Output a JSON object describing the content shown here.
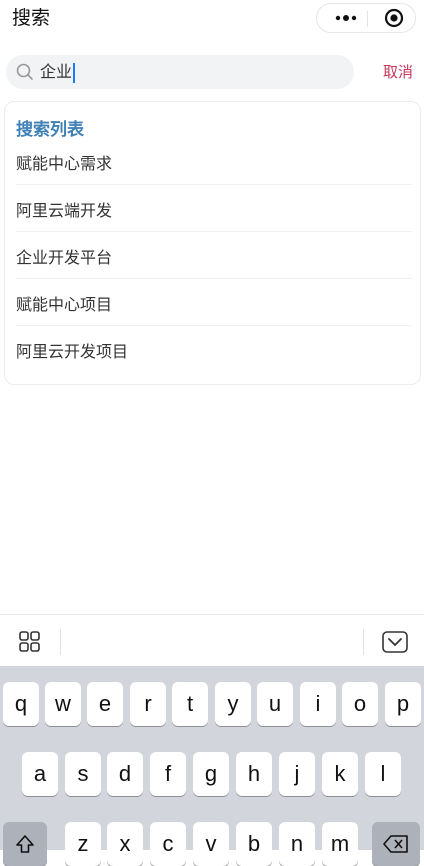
{
  "header": {
    "title": "搜索"
  },
  "search": {
    "value": "企业",
    "cancel_label": "取消"
  },
  "results": {
    "heading": "搜索列表",
    "items": [
      "赋能中心需求",
      "阿里云端开发",
      "企业开发平台",
      "赋能中心项目",
      "阿里云开发项目"
    ]
  },
  "keyboard": {
    "row1": [
      "q",
      "w",
      "e",
      "r",
      "t",
      "y",
      "u",
      "i",
      "o",
      "p"
    ],
    "row2": [
      "a",
      "s",
      "d",
      "f",
      "g",
      "h",
      "j",
      "k",
      "l"
    ],
    "row3": [
      "z",
      "x",
      "c",
      "v",
      "b",
      "n",
      "m"
    ]
  },
  "colors": {
    "accent": "#c8375c",
    "heading": "#3f80b5",
    "caret": "#1a7cff"
  },
  "icons": [
    "more-dots-icon",
    "target-close-icon",
    "search-icon",
    "grid-icon",
    "keyboard-hide-icon",
    "shift-icon",
    "backspace-icon"
  ]
}
